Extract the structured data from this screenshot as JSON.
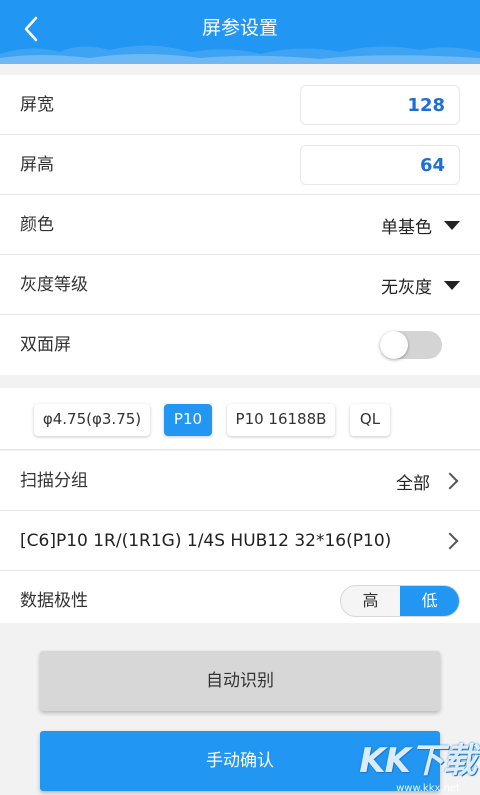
{
  "header": {
    "title": "屏参设置"
  },
  "fields": {
    "width": {
      "label": "屏宽",
      "value": "128"
    },
    "height": {
      "label": "屏高",
      "value": "64"
    },
    "color": {
      "label": "颜色",
      "value": "单基色"
    },
    "gray": {
      "label": "灰度等级",
      "value": "无灰度"
    },
    "double": {
      "label": "双面屏",
      "on": false
    }
  },
  "chips": [
    {
      "label": "φ4.75(φ3.75)",
      "active": false
    },
    {
      "label": "P10",
      "active": true
    },
    {
      "label": "P10 16188B",
      "active": false
    },
    {
      "label": "QL",
      "active": false
    }
  ],
  "scan": {
    "label": "扫描分组",
    "value": "全部"
  },
  "module": {
    "label": "[C6]P10 1R/(1R1G) 1/4S HUB12 32*16(P10)"
  },
  "polarity": {
    "label": "数据极性",
    "high": "高",
    "low": "低",
    "selected": "低"
  },
  "buttons": {
    "auto": "自动识别",
    "manual": "手动确认"
  },
  "watermark": {
    "text": "KK下载",
    "url": "www.kkx.net"
  }
}
